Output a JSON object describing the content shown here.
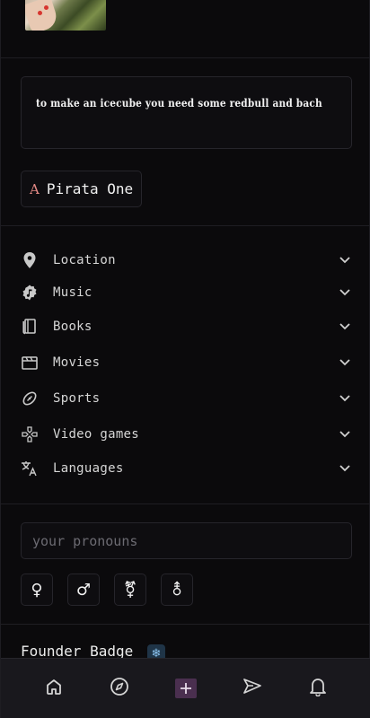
{
  "quote": {
    "text": "to make an icecube you need some redbull and bach"
  },
  "font_chip": {
    "glyph": "A",
    "name": "Pirata One"
  },
  "interests": [
    {
      "icon": "location-pin-icon",
      "label": "Location"
    },
    {
      "icon": "music-icon",
      "label": "Music"
    },
    {
      "icon": "book-icon",
      "label": "Books"
    },
    {
      "icon": "film-icon",
      "label": "Movies"
    },
    {
      "icon": "football-icon",
      "label": "Sports"
    },
    {
      "icon": "gamepad-icon",
      "label": "Video games"
    },
    {
      "icon": "translate-icon",
      "label": "Languages"
    }
  ],
  "pronouns": {
    "placeholder": "your pronouns"
  },
  "gender_symbols": [
    "♀",
    "♂",
    "⚧",
    "⚨"
  ],
  "badge": {
    "title": "Founder Badge",
    "emoji": "❄"
  },
  "nav": [
    "home-icon",
    "explore-icon",
    "create-icon",
    "send-icon",
    "notifications-icon"
  ],
  "colors": {
    "background": "#0b0a0c",
    "accent_plus": "#4a2f4f",
    "font_glyph": "#e58a86",
    "badge_bg": "#1f3447"
  }
}
